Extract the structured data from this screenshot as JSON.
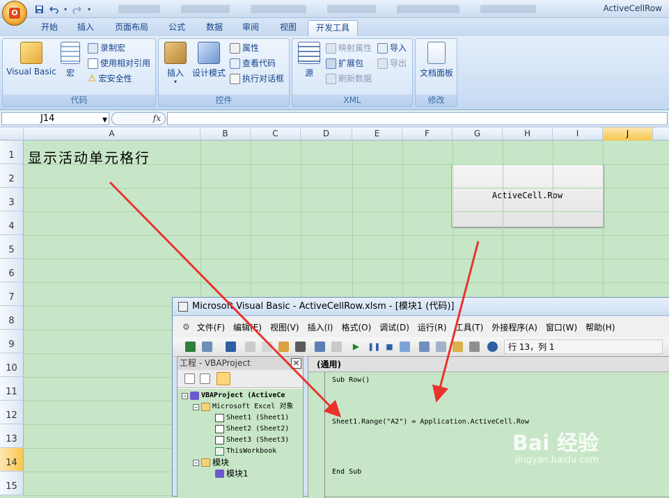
{
  "window": {
    "title": "ActiveCellRow"
  },
  "quick_access": [
    "save-icon",
    "undo-icon",
    "redo-icon"
  ],
  "ribbon": {
    "tabs": [
      "开始",
      "插入",
      "页面布局",
      "公式",
      "数据",
      "审阅",
      "视图",
      "开发工具"
    ],
    "active_tab": "开发工具",
    "groups": {
      "code": {
        "label": "代码",
        "visual_basic": "Visual Basic",
        "macros": "宏",
        "record_macro": "录制宏",
        "relative_ref": "使用相对引用",
        "macro_security": "宏安全性"
      },
      "controls": {
        "label": "控件",
        "insert": "插入",
        "design_mode": "设计模式",
        "properties": "属性",
        "view_code": "查看代码",
        "run_dialog": "执行对话框"
      },
      "xml": {
        "label": "XML",
        "source": "源",
        "map_properties": "映射属性",
        "expansion_packs": "扩展包",
        "refresh_data": "刷新数据",
        "import": "导入",
        "export": "导出"
      },
      "modify": {
        "label": "修改",
        "doc_panel": "文档面板"
      }
    }
  },
  "formula_bar": {
    "name_box": "J14",
    "fx": "fx",
    "value": ""
  },
  "sheet": {
    "columns": [
      "A",
      "B",
      "C",
      "D",
      "E",
      "F",
      "G",
      "H",
      "I",
      "J"
    ],
    "selected_column": "J",
    "rows": [
      "1",
      "2",
      "3",
      "4",
      "5",
      "6",
      "7",
      "8",
      "9",
      "10",
      "11",
      "12",
      "13",
      "14",
      "15"
    ],
    "selected_row": "14",
    "cell_A1": "显示活动单元格行",
    "button_label": "ActiveCell.Row"
  },
  "vbe": {
    "title": "Microsoft Visual Basic - ActiveCellRow.xlsm - [模块1 (代码)]",
    "menu": [
      "文件(F)",
      "编辑(E)",
      "视图(V)",
      "插入(I)",
      "格式(O)",
      "调试(D)",
      "运行(R)",
      "工具(T)",
      "外接程序(A)",
      "窗口(W)",
      "帮助(H)"
    ],
    "cursor_position": "行 13，列 1",
    "project_panel": {
      "title": "工程 - VBAProject",
      "tree": [
        {
          "label": "VBAProject (ActiveCe",
          "bold": true
        },
        {
          "label": "Microsoft Excel 对象"
        },
        {
          "label": "Sheet1 (Sheet1)"
        },
        {
          "label": "Sheet2 (Sheet2)"
        },
        {
          "label": "Sheet3 (Sheet3)"
        },
        {
          "label": "ThisWorkbook"
        },
        {
          "label": "模块"
        },
        {
          "label": "模块1"
        }
      ]
    },
    "code": {
      "object_combo": "(通用)",
      "lines": [
        "Sub Row()",
        "Sheet1.Range(\"A2\") = Application.ActiveCell.Row",
        "End Sub"
      ]
    }
  },
  "watermark": {
    "logo": "Bai 经验",
    "url": "jingyan.baidu.com"
  },
  "colors": {
    "sheet_bg": "#c7e6c7",
    "arrow": "#e8332c",
    "selection": "#f9c64d"
  }
}
